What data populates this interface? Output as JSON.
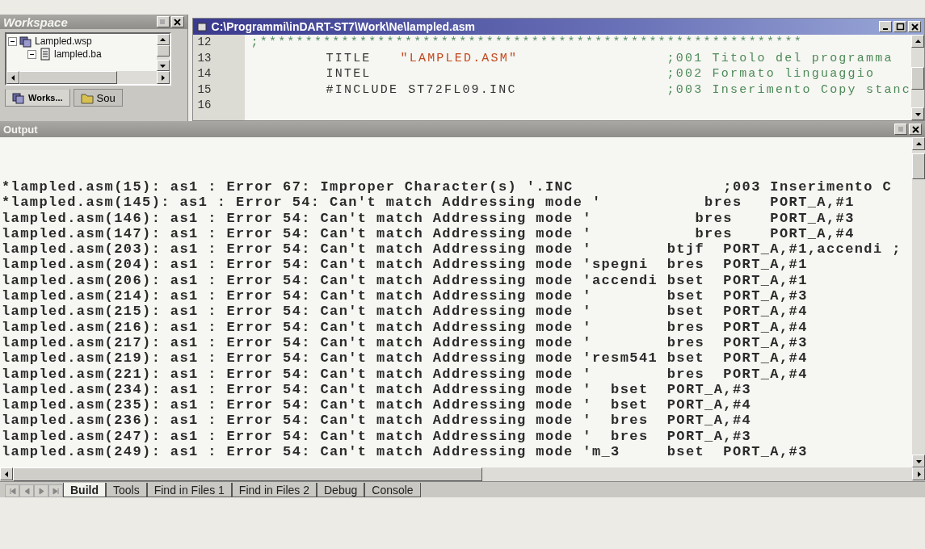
{
  "workspace": {
    "title": "Workspace",
    "tree": [
      {
        "label": "Lampled.wsp",
        "expanded": true,
        "children": [
          {
            "label": "lampled.ba",
            "expanded": true
          }
        ]
      }
    ],
    "tabs": [
      {
        "label": "Works...",
        "selected": true
      },
      {
        "label": "Sou",
        "selected": false
      }
    ]
  },
  "editor": {
    "title": "C:\\Programmi\\inDART-ST7\\Work\\Ne\\lampled.asm",
    "lines": [
      {
        "number": "12",
        "kind": "comment",
        "comment": ";************************************************************"
      },
      {
        "number": "13",
        "kind": "string",
        "instruction": "TITLE",
        "operand": "\"LAMPLED.ASM\"",
        "comment": ";001 Titolo del programma"
      },
      {
        "number": "14",
        "kind": "plain",
        "instruction": "INTEL",
        "comment": ";002 Formato linguaggio"
      },
      {
        "number": "15",
        "kind": "plain",
        "instruction": "#INCLUDE",
        "operand": "ST72FL09.INC",
        "comment": ";003 Inserimento Copy stanc"
      },
      {
        "number": "16",
        "kind": "blank"
      }
    ]
  },
  "output": {
    "title": "Output",
    "lines": [
      "*lampled.asm(15): as1 : Error 67: Improper Character(s) '.INC                ;003 Inserimento C",
      "*lampled.asm(145): as1 : Error 54: Can't match Addressing mode '           bres   PORT_A,#1",
      "lampled.asm(146): as1 : Error 54: Can't match Addressing mode '           bres    PORT_A,#3",
      "lampled.asm(147): as1 : Error 54: Can't match Addressing mode '           bres    PORT_A,#4",
      "lampled.asm(203): as1 : Error 54: Can't match Addressing mode '        btjf  PORT_A,#1,accendi ;",
      "lampled.asm(204): as1 : Error 54: Can't match Addressing mode 'spegni  bres  PORT_A,#1",
      "lampled.asm(206): as1 : Error 54: Can't match Addressing mode 'accendi bset  PORT_A,#1",
      "lampled.asm(214): as1 : Error 54: Can't match Addressing mode '        bset  PORT_A,#3",
      "lampled.asm(215): as1 : Error 54: Can't match Addressing mode '        bset  PORT_A,#4",
      "lampled.asm(216): as1 : Error 54: Can't match Addressing mode '        bres  PORT_A,#4",
      "lampled.asm(217): as1 : Error 54: Can't match Addressing mode '        bres  PORT_A,#3",
      "lampled.asm(219): as1 : Error 54: Can't match Addressing mode 'resm541 bset  PORT_A,#4",
      "lampled.asm(221): as1 : Error 54: Can't match Addressing mode '        bres  PORT_A,#4",
      "lampled.asm(234): as1 : Error 54: Can't match Addressing mode '  bset  PORT_A,#3",
      "lampled.asm(235): as1 : Error 54: Can't match Addressing mode '  bset  PORT_A,#4",
      "lampled.asm(236): as1 : Error 54: Can't match Addressing mode '  bres  PORT_A,#4",
      "lampled.asm(247): as1 : Error 54: Can't match Addressing mode '  bres  PORT_A,#3",
      "lampled.asm(249): as1 : Error 54: Can't match Addressing mode 'm_3     bset  PORT_A,#3"
    ],
    "tabs": [
      {
        "label": "Build",
        "selected": true
      },
      {
        "label": "Tools",
        "selected": false
      },
      {
        "label": "Find in Files 1",
        "selected": false
      },
      {
        "label": "Find in Files 2",
        "selected": false
      },
      {
        "label": "Debug",
        "selected": false
      },
      {
        "label": "Console",
        "selected": false
      }
    ]
  }
}
